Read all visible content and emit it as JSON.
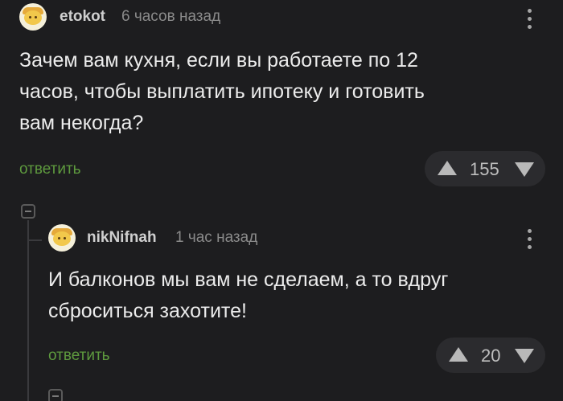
{
  "comments": [
    {
      "username": "etokot",
      "time": "6 часов назад",
      "text_lines": [
        "Зачем вам кухня, если вы работаете по 12",
        "часов, чтобы выплатить ипотеку и готовить",
        "вам некогда?"
      ],
      "reply_label": "ответить",
      "rating": "155"
    },
    {
      "username": "nikNifnah",
      "time": "1 час назад",
      "text_lines": [
        "И балконов мы вам не сделаем, а то вдруг",
        "сброситься захотите!"
      ],
      "reply_label": "ответить",
      "rating": "20"
    }
  ],
  "icons": {
    "upvote": "triangle-up-icon",
    "downvote": "triangle-down-icon",
    "menu": "kebab-menu-icon",
    "collapse": "collapse-minus-icon"
  },
  "colors": {
    "background": "#1d1d1f",
    "reply_link": "#5e9a3e",
    "rating_pill": "#2b2b2e"
  }
}
